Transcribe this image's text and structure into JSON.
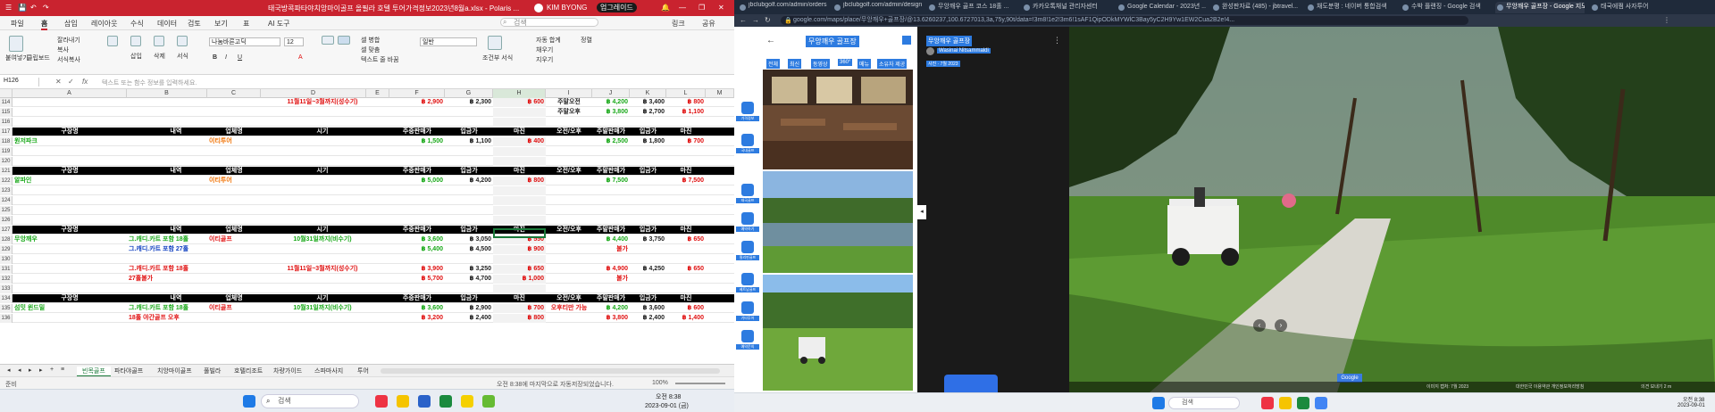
{
  "excel": {
    "title": "태국방콕파타야치앙마이골프 올필라 호텔 투어가격정보2023년8월a.xlsx - Polaris ...",
    "user_name": "KIM BYONG",
    "upgrade_label": "업그레이드",
    "search_placeholder": "검색",
    "link_label": "링크",
    "share_label": "공유",
    "ribbon_tabs": [
      "파일",
      "홈",
      "삽입",
      "레이아웃",
      "수식",
      "데이터",
      "검토",
      "보기",
      "표",
      "AI 도구"
    ],
    "ribbon": {
      "paste": "붙여넣기",
      "format_copy": "클립보드",
      "cut": "잘라내기",
      "copy": "복사",
      "format_painter": "서식복사",
      "insert": "삽입",
      "delete": "삭제",
      "format": "서식",
      "font_name": "나눔바른고딕",
      "font_size": "12",
      "bold": "B",
      "italic": "I",
      "underline": "U",
      "wrap_text": "텍스트 줄 바꿈",
      "merge": "셀 병합",
      "merge_center": "셀 맞춤",
      "number_format": "일반",
      "conditional": "조건부 서식",
      "autosum": "자동 합계",
      "fill": "채우기",
      "clear": "지우기",
      "sort": "정렬"
    },
    "cell_ref": "H126",
    "formula_placeholder": "텍스트 또는 함수 정보를 입력하세요.",
    "columns": [
      "A",
      "B",
      "C",
      "D",
      "E",
      "F",
      "G",
      "H",
      "I",
      "J",
      "K",
      "L",
      "M"
    ],
    "rows": [
      {
        "n": "114",
        "cells": {
          "D": [
            "11월11일~3월까지(성수기)",
            "rd"
          ],
          "F": [
            "฿ 2,900",
            "rd"
          ],
          "G": [
            "฿ 2,300",
            "bk"
          ],
          "H": [
            "฿ 600",
            "rd"
          ],
          "I": [
            "주말오전",
            "bk"
          ],
          "J": [
            "฿ 4,200",
            "g"
          ],
          "K": [
            "฿ 3,400",
            "bk"
          ],
          "L": [
            "฿ 800",
            "rd"
          ]
        }
      },
      {
        "n": "115",
        "cells": {
          "I": [
            "주말오후",
            "bk"
          ],
          "J": [
            "฿ 3,800",
            "g"
          ],
          "K": [
            "฿ 2,700",
            "bk"
          ],
          "L": [
            "฿ 1,100",
            "rd"
          ]
        }
      },
      {
        "n": "116",
        "cells": {}
      },
      {
        "n": "117",
        "hdr": true,
        "cells": {
          "A": [
            "구장명",
            "w"
          ],
          "B": [
            "내역",
            "w"
          ],
          "C": [
            "업체명",
            "w"
          ],
          "D": [
            "시기",
            "w"
          ],
          "F": [
            "주중판매가",
            "w"
          ],
          "G": [
            "입금가",
            "w"
          ],
          "H": [
            "마진",
            "w"
          ],
          "I": [
            "오전/오후",
            "w"
          ],
          "J": [
            "주말판매가",
            "w"
          ],
          "K": [
            "입금가",
            "w"
          ],
          "L": [
            "마진",
            "w"
          ]
        }
      },
      {
        "n": "118",
        "cells": {
          "A": [
            "원저파크",
            "g"
          ],
          "C": [
            "이티투어",
            "o"
          ],
          "F": [
            "฿ 1,500",
            "g"
          ],
          "G": [
            "฿ 1,100",
            "bk"
          ],
          "H": [
            "฿ 400",
            "rd"
          ],
          "J": [
            "฿ 2,500",
            "g"
          ],
          "K": [
            "฿ 1,800",
            "bk"
          ],
          "L": [
            "฿ 700",
            "rd"
          ]
        }
      },
      {
        "n": "119",
        "cells": {}
      },
      {
        "n": "120",
        "cells": {}
      },
      {
        "n": "121",
        "hdr": true,
        "cells": {
          "A": [
            "구장명",
            "w"
          ],
          "B": [
            "내역",
            "w"
          ],
          "C": [
            "업체명",
            "w"
          ],
          "D": [
            "시기",
            "w"
          ],
          "F": [
            "주중판매가",
            "w"
          ],
          "G": [
            "입금가",
            "w"
          ],
          "H": [
            "마진",
            "w"
          ],
          "I": [
            "오전/오후",
            "w"
          ],
          "J": [
            "주말판매가",
            "w"
          ],
          "K": [
            "입금가",
            "w"
          ],
          "L": [
            "마진",
            "w"
          ]
        }
      },
      {
        "n": "122",
        "cells": {
          "A": [
            "알파인",
            "g"
          ],
          "C": [
            "이티투어",
            "o"
          ],
          "F": [
            "฿ 5,000",
            "g"
          ],
          "G": [
            "฿ 4,200",
            "bk"
          ],
          "H": [
            "฿ 800",
            "rd"
          ],
          "J": [
            "฿ 7,500",
            "g"
          ],
          "L": [
            "฿ 7,500",
            "rd"
          ]
        }
      },
      {
        "n": "123",
        "cells": {}
      },
      {
        "n": "124",
        "cells": {}
      },
      {
        "n": "125",
        "cells": {}
      },
      {
        "n": "126",
        "cells": {}
      },
      {
        "n": "127",
        "hdr": true,
        "cells": {
          "A": [
            "구장명",
            "w"
          ],
          "B": [
            "내역",
            "w"
          ],
          "C": [
            "업체명",
            "w"
          ],
          "D": [
            "시기",
            "w"
          ],
          "F": [
            "주중판매가",
            "w"
          ],
          "G": [
            "입금가",
            "w"
          ],
          "H": [
            "마진",
            "w"
          ],
          "I": [
            "오전/오후",
            "w"
          ],
          "J": [
            "주말판매가",
            "w"
          ],
          "K": [
            "입금가",
            "w"
          ],
          "L": [
            "마진",
            "w"
          ]
        }
      },
      {
        "n": "128",
        "cells": {
          "A": [
            "무앙깨우",
            "g"
          ],
          "B": [
            "그.캐디.카트 포함 18홀",
            "g"
          ],
          "C": [
            "이티골프",
            "rd"
          ],
          "D": [
            "10월31일까지(비수기)",
            "g"
          ],
          "F": [
            "฿ 3,600",
            "g"
          ],
          "G": [
            "฿ 3,050",
            "bk"
          ],
          "H": [
            "฿ 550",
            "rd"
          ],
          "J": [
            "฿ 4,400",
            "g"
          ],
          "K": [
            "฿ 3,750",
            "bk"
          ],
          "L": [
            "฿ 650",
            "rd"
          ]
        }
      },
      {
        "n": "129",
        "cells": {
          "B": [
            "그.캐디.카트 포함 27홀",
            "bl"
          ],
          "F": [
            "฿ 5,400",
            "g"
          ],
          "G": [
            "฿ 4,500",
            "bk"
          ],
          "H": [
            "฿ 900",
            "rd"
          ],
          "J": [
            "불가",
            "rd"
          ]
        }
      },
      {
        "n": "130",
        "cells": {}
      },
      {
        "n": "131",
        "cells": {
          "B": [
            "그.캐디.카트 포함 18홀",
            "rd"
          ],
          "D": [
            "11월11일~3월까지(성수기)",
            "rd"
          ],
          "F": [
            "฿ 3,900",
            "rd"
          ],
          "G": [
            "฿ 3,250",
            "bk"
          ],
          "H": [
            "฿ 650",
            "rd"
          ],
          "J": [
            "฿ 4,900",
            "rd"
          ],
          "K": [
            "฿ 4,250",
            "bk"
          ],
          "L": [
            "฿ 650",
            "rd"
          ]
        }
      },
      {
        "n": "132",
        "cells": {
          "B": [
            "27홀불가",
            "rd"
          ],
          "F": [
            "฿ 5,700",
            "rd"
          ],
          "G": [
            "฿ 4,700",
            "bk"
          ],
          "H": [
            "฿ 1,000",
            "rd"
          ],
          "J": [
            "불가",
            "rd"
          ]
        }
      },
      {
        "n": "133",
        "cells": {}
      },
      {
        "n": "134",
        "hdr": true,
        "cells": {
          "A": [
            "구장명",
            "w"
          ],
          "B": [
            "내역",
            "w"
          ],
          "C": [
            "업체명",
            "w"
          ],
          "D": [
            "시기",
            "w"
          ],
          "F": [
            "주중판매가",
            "w"
          ],
          "G": [
            "입금가",
            "w"
          ],
          "H": [
            "마진",
            "w"
          ],
          "I": [
            "오전/오후",
            "w"
          ],
          "J": [
            "주말판매가",
            "w"
          ],
          "K": [
            "입금가",
            "w"
          ],
          "L": [
            "마진",
            "w"
          ]
        }
      },
      {
        "n": "135",
        "cells": {
          "A": [
            "섬밋 윈드밀",
            "g"
          ],
          "B": [
            "그.캐디.카트 포함 18홀",
            "g"
          ],
          "C": [
            "이티골프",
            "rd"
          ],
          "D": [
            "10월31일까지(비수기)",
            "g"
          ],
          "F": [
            "฿ 3,600",
            "g"
          ],
          "G": [
            "฿ 2,900",
            "bk"
          ],
          "H": [
            "฿ 700",
            "rd"
          ],
          "I": [
            "오후티만 가능",
            "rd"
          ],
          "J": [
            "฿ 4,200",
            "g"
          ],
          "K": [
            "฿ 3,600",
            "bk"
          ],
          "L": [
            "฿ 600",
            "rd"
          ]
        }
      },
      {
        "n": "136",
        "cells": {
          "B": [
            "18홀 야간골프 오후",
            "rd"
          ],
          "F": [
            "฿ 3,200",
            "rd"
          ],
          "G": [
            "฿ 2,400",
            "bk"
          ],
          "H": [
            "฿ 800",
            "rd"
          ],
          "J": [
            "฿ 3,800",
            "rd"
          ],
          "K": [
            "฿ 2,400",
            "bk"
          ],
          "L": [
            "฿ 1,400",
            "rd"
          ]
        }
      }
    ],
    "sheet_tabs": [
      "빈목골프",
      "파타야골프",
      "치앙마이골프",
      "풀빌라",
      "호텔리조트",
      "차량가이드",
      "스파마사지",
      "투어"
    ],
    "status_left": "준비",
    "status_autosave": "오전 8:38에 마지막으로 자동저장되었습니다.",
    "zoom": "100%"
  },
  "taskbar_left": {
    "search_placeholder": "검색",
    "time": "오전 8:38",
    "date": "2023-09-01 (금)"
  },
  "chrome": {
    "tabs": [
      "jbclubgolf.com/admin/orders",
      "jbclubgolf.com/admin/design",
      "무앙깨우 골프 코스 18홀 ...",
      "카카오톡채널 관리자센터",
      "Google Calendar - 2023년 ...",
      "완성판자료 (485) - jbtravel...",
      "채도분평 : 네이버 통합검색",
      "수박 플랜징 - Google 검색",
      "무앙깨우 골프장 - Google 지도",
      "태국에쩜 사자투어"
    ],
    "url": "google.com/maps/place/무앙깨우+골프장/@13.6260237,100.6727013,3a,75y,90t/data=!3m8!1e2!3m6!1sAF1QipODkMYWlC3Bay5yC2H9Yw1EW2Cua2B2e!4...",
    "side_labels": [
      "가격정보",
      "국내골프",
      "태국골프",
      "예약하기",
      "필리핀골프",
      "베트남골프",
      "기타투어",
      "예약문의"
    ],
    "maps": {
      "place_title": "무앙깨우 골프장",
      "photographer": "Wasinai Nitsammaldi",
      "date_label": "사진 · 7월 2023",
      "menu": [
        "전체",
        "최신",
        "동영상",
        "360°",
        "메뉴",
        "소유자 제공"
      ],
      "google_label": "Google",
      "footer_left": "이미지 캡처: 7월 2023",
      "footer_mid": "대한민국 이용약관 개인정보처리방침",
      "footer_right": "의견 보내기 2 m"
    }
  },
  "taskbar_right": {
    "search_placeholder": "검색",
    "time": "오전 8:38",
    "date": "2023-09-01"
  }
}
